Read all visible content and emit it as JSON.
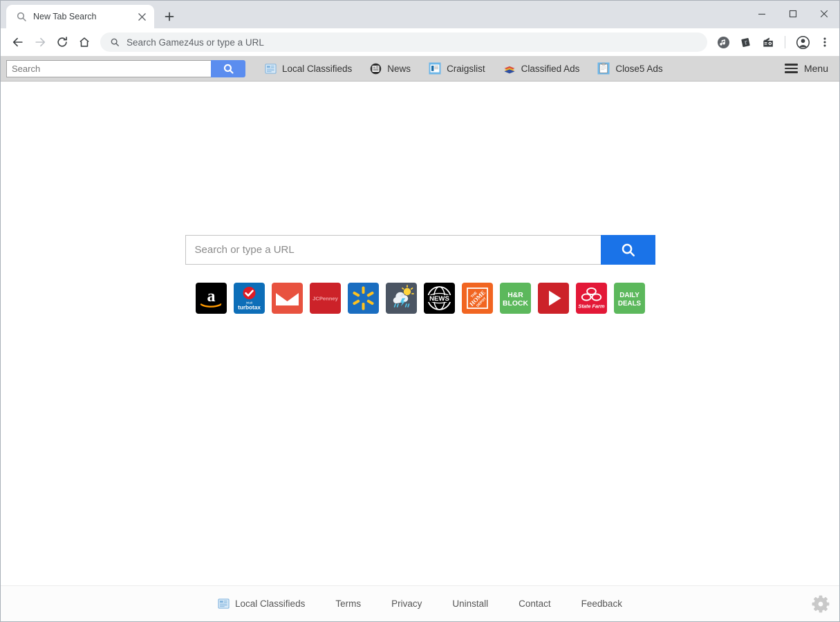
{
  "browser": {
    "tab": {
      "title": "New Tab Search",
      "favicon": "search-icon",
      "close": "×"
    },
    "newtab_label": "+",
    "window_controls": {
      "minimize": "−",
      "maximize": "□",
      "close": "×"
    },
    "nav": {
      "back": "back-arrow-icon",
      "forward": "forward-arrow-icon",
      "reload": "reload-icon",
      "home": "home-icon"
    },
    "omnibox": {
      "placeholder": "Search Gamez4us or type a URL",
      "value": "",
      "icon": "search-icon"
    },
    "extensions": [
      "music-note-icon",
      "dark-card-icon",
      "radio-icon"
    ],
    "profile_icon": "account-avatar-icon",
    "menu_icon": "three-dot-menu-icon"
  },
  "toolbar": {
    "search": {
      "placeholder": "Search",
      "value": "",
      "button_icon": "search-icon"
    },
    "links": [
      {
        "label": "Local Classifieds",
        "icon": "local-classifieds-icon"
      },
      {
        "label": "News",
        "icon": "news-icon"
      },
      {
        "label": "Craigslist",
        "icon": "craigslist-icon"
      },
      {
        "label": "Classified Ads",
        "icon": "classified-ads-layers-icon"
      },
      {
        "label": "Close5 Ads",
        "icon": "clipboard-icon"
      }
    ],
    "menu_label": "Menu",
    "accent_color": "#5b8def"
  },
  "main": {
    "search": {
      "placeholder": "Search or type a URL",
      "value": "",
      "button_icon": "search-icon",
      "button_color": "#1a73e8"
    },
    "tiles": [
      {
        "name": "Amazon",
        "icon": "amazon-icon",
        "bg": "#000000"
      },
      {
        "name": "TurboTax",
        "icon": "turbotax-icon",
        "bg": "#0d6eb8",
        "sublabel": "intuit",
        "label": "turbotax"
      },
      {
        "name": "Gmail",
        "icon": "gmail-icon",
        "bg": "#e8523f"
      },
      {
        "name": "JCPenney",
        "icon": "jcpenney-icon",
        "bg": "#cc2229",
        "label": "JCPenney"
      },
      {
        "name": "Walmart",
        "icon": "walmart-icon",
        "bg": "#1a6dc0"
      },
      {
        "name": "Weather",
        "icon": "weather-icon",
        "bg": "#4b5563"
      },
      {
        "name": "News",
        "icon": "news-globe-icon",
        "bg": "#000000",
        "label": "NEWS"
      },
      {
        "name": "Home Depot",
        "icon": "home-depot-icon",
        "bg": "#f16521",
        "label": "THE HOME DEPOT"
      },
      {
        "name": "H&R Block",
        "icon": "hrblock-icon",
        "bg": "#5cb85c",
        "label": "H&R BLOCK"
      },
      {
        "name": "YouTube",
        "icon": "youtube-icon",
        "bg": "#cc2229"
      },
      {
        "name": "State Farm",
        "icon": "statefarm-icon",
        "bg": "#e31837",
        "label": "State Farm"
      },
      {
        "name": "Daily Deals",
        "icon": "daily-deals-icon",
        "bg": "#5cb85c",
        "label": "DAILY DEALS"
      }
    ]
  },
  "footer": {
    "links": [
      {
        "label": "Local Classifieds",
        "icon": "local-classifieds-icon"
      },
      {
        "label": "Terms",
        "icon": ""
      },
      {
        "label": "Privacy",
        "icon": ""
      },
      {
        "label": "Uninstall",
        "icon": ""
      },
      {
        "label": "Contact",
        "icon": ""
      },
      {
        "label": "Feedback",
        "icon": ""
      }
    ],
    "settings_icon": "gear-icon"
  }
}
